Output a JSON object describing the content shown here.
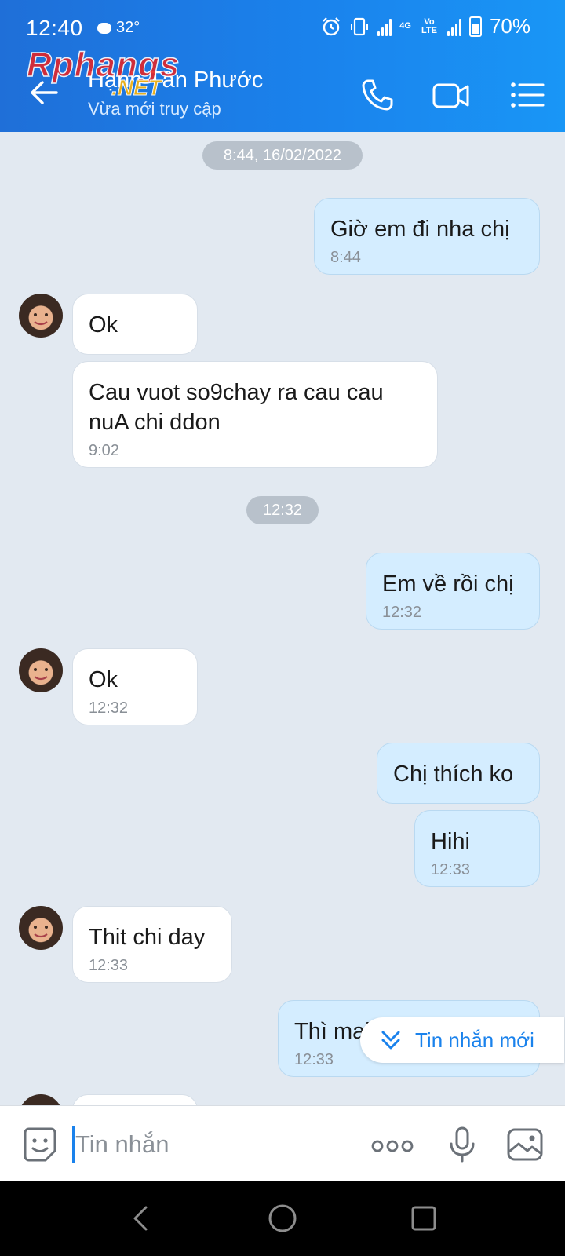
{
  "status_bar": {
    "time": "12:40",
    "temperature": "32°",
    "network": "4G",
    "volte": "Vo LTE",
    "battery": "70%",
    "battery_level": 0.7
  },
  "header": {
    "contact_name": "Hạnh Tân Phước",
    "contact_status": "Vừa mới truy cập",
    "watermark_main": "Rphangs",
    "watermark_sub": ".NET",
    "icons": [
      "back-arrow-icon",
      "phone-icon",
      "video-call-icon",
      "menu-list-icon"
    ]
  },
  "conversation": {
    "date_divider": "8:44, 16/02/2022",
    "time_divider": "12:32",
    "messages": [
      {
        "dir": "out",
        "text": "Giờ em đi nha chị",
        "time": "8:44"
      },
      {
        "dir": "in",
        "text": "Ok",
        "time": ""
      },
      {
        "dir": "in",
        "text": "Cau vuot  so9chay ra cau cau nuA chi ddon",
        "time": "9:02"
      },
      {
        "dir": "out",
        "text": "Em về rồi chị",
        "time": "12:32"
      },
      {
        "dir": "in",
        "text": "Ok",
        "time": "12:32"
      },
      {
        "dir": "out",
        "text": "Chị thích ko",
        "time": ""
      },
      {
        "dir": "out",
        "text": "Hihi",
        "time": "12:33"
      },
      {
        "dir": "in",
        "text": "Thit chi day",
        "time": "12:33"
      },
      {
        "dir": "out",
        "text": "Thì mai mốt làm nữa",
        "time": "12:33"
      }
    ],
    "new_message_button": "Tin nhắn mới"
  },
  "composer": {
    "placeholder": "Tin nhắn",
    "icons": [
      "sticker-icon",
      "more-options-icon",
      "microphone-icon",
      "gallery-icon"
    ]
  },
  "navigation": {
    "icons": [
      "nav-back-icon",
      "nav-home-icon",
      "nav-recents-icon"
    ]
  }
}
